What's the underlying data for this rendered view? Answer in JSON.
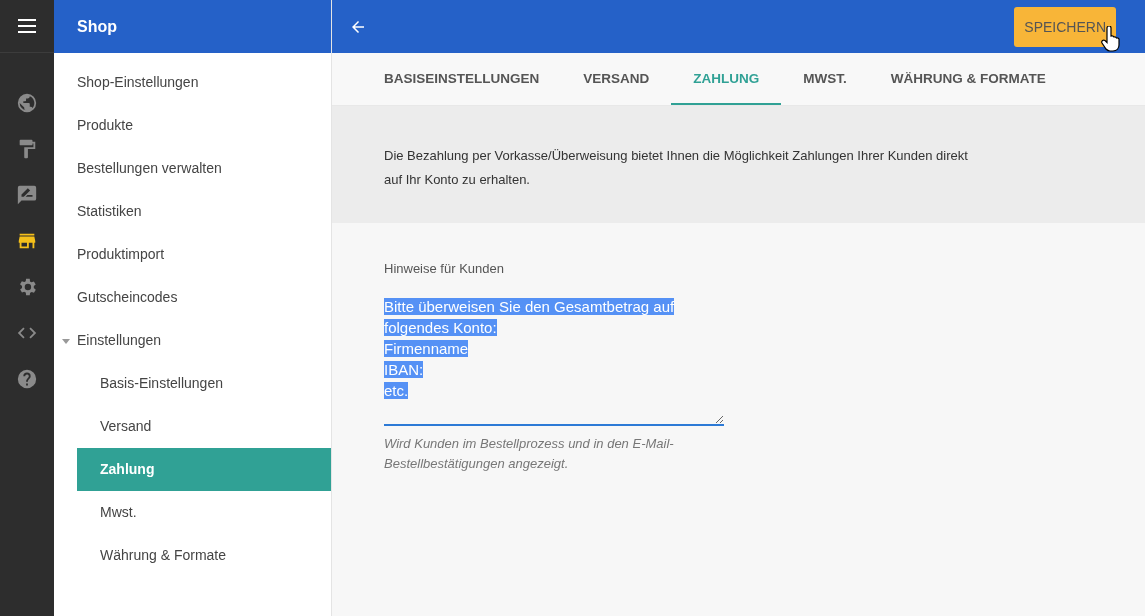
{
  "rail": [
    {
      "kind": "globe",
      "selected": false
    },
    {
      "kind": "roller",
      "selected": false
    },
    {
      "kind": "feedback",
      "selected": false
    },
    {
      "kind": "store",
      "selected": true
    },
    {
      "kind": "gear",
      "selected": false
    },
    {
      "kind": "code",
      "selected": false
    },
    {
      "kind": "help",
      "selected": false
    }
  ],
  "sidebar": {
    "title": "Shop",
    "items": [
      {
        "label": "Shop-Einstellungen",
        "selected": false
      },
      {
        "label": "Produkte",
        "selected": false
      },
      {
        "label": "Bestellungen verwalten",
        "selected": false
      },
      {
        "label": "Statistiken",
        "selected": false
      },
      {
        "label": "Produktimport",
        "selected": false
      },
      {
        "label": "Gutscheincodes",
        "selected": false
      },
      {
        "label": "Einstellungen",
        "selected": false,
        "expanded": true,
        "children": [
          {
            "label": "Basis-Einstellungen",
            "selected": false
          },
          {
            "label": "Versand",
            "selected": false
          },
          {
            "label": "Zahlung",
            "selected": true
          },
          {
            "label": "Mwst.",
            "selected": false
          },
          {
            "label": "Währung & Formate",
            "selected": false
          }
        ]
      }
    ]
  },
  "toolbar": {
    "save_button": "SPEICHERN"
  },
  "tabs": [
    {
      "label": "BASISEINSTELLUNGEN",
      "selected": false
    },
    {
      "label": "VERSAND",
      "selected": false
    },
    {
      "label": "ZAHLUNG",
      "selected": true
    },
    {
      "label": "MWST.",
      "selected": false
    },
    {
      "label": "WÄHRUNG & FORMATE",
      "selected": false
    }
  ],
  "info": "Die Bezahlung per Vorkasse/Überweisung bietet Ihnen die Möglichkeit Zahlungen Ihrer Kunden direkt auf Ihr Konto zu erhalten.",
  "notes_field": {
    "label": "Hinweise für Kunden",
    "text_selected": true,
    "value_lines": [
      "Bitte überweisen Sie den Gesamtbetrag auf",
      "folgendes Konto:",
      "Firmenname",
      "IBAN:",
      "etc."
    ],
    "help": "Wird Kunden im Bestellprozess und in den E-Mail-Bestellbestätigungen angezeigt."
  }
}
